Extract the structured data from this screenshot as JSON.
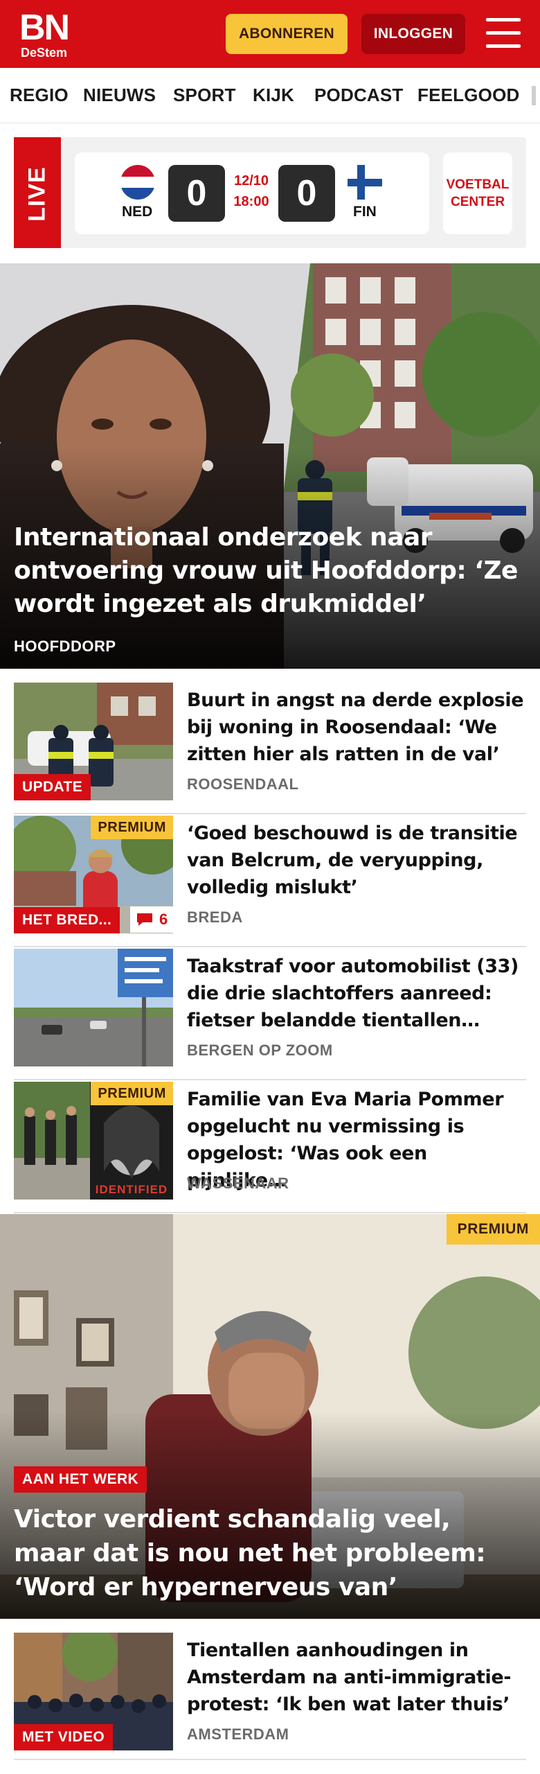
{
  "header": {
    "logo_main": "BN",
    "logo_sub": "DeStem",
    "subscribe_label": "ABONNEREN",
    "login_label": "INLOGGEN"
  },
  "nav": {
    "items": [
      {
        "label": "REGIO"
      },
      {
        "label": "NIEUWS"
      },
      {
        "label": "SPORT"
      },
      {
        "label": "KIJK"
      },
      {
        "label": "PODCAST"
      },
      {
        "label": "FEELGOOD"
      }
    ]
  },
  "live": {
    "tag": "LIVE",
    "home_team": "NED",
    "home_score": "0",
    "away_team": "FIN",
    "away_score": "0",
    "date": "12/10",
    "time": "18:00",
    "voetbal_center": "VOETBAL CENTER"
  },
  "hero1": {
    "title": "Internationaal onderzoek naar ontvoering vrouw uit Hoofddorp: ‘Ze wordt ingezet als drukmiddel’",
    "location": "HOOFDDORP"
  },
  "articles": [
    {
      "title": "Buurt in angst na derde explosie bij woning in Roosendaal: ‘We zitten hier als ratten in de val’",
      "location": "ROOSENDAAL",
      "badge": "UPDATE"
    },
    {
      "title": "‘Goed beschouwd is de transitie van Belcrum, de veryupping, volledig mislukt’",
      "location": "BREDA",
      "badge": "HET BRED...",
      "premium": "PREMIUM",
      "comments": "6"
    },
    {
      "title": "Taakstraf voor automobilist (33) die drie slachtoffers aanreed: fietser belandde tientallen…",
      "location": "BERGEN OP ZOOM"
    },
    {
      "title": "Familie van Eva Maria Pommer opgelucht nu vermissing is opgelost: ‘Was ook een pijnlijke…",
      "location": "WASSENAAR",
      "premium": "PREMIUM",
      "image_text": "IDENTIFIED"
    }
  ],
  "hero2": {
    "premium": "PREMIUM",
    "badge": "AAN HET WERK",
    "title": "Victor verdient schandalig veel, maar dat is nou net het probleem: ‘Word er hypernerveus van’"
  },
  "article5": {
    "title": "Tientallen aanhoudingen in Amsterdam na anti-immigratie-protest: ‘Ik ben wat later thuis’",
    "location": "AMSTERDAM",
    "badge": "MET VIDEO"
  },
  "colors": {
    "brand_red": "#d40e14",
    "premium_yellow": "#f8c43a",
    "login_dark_red": "#a5060d"
  }
}
